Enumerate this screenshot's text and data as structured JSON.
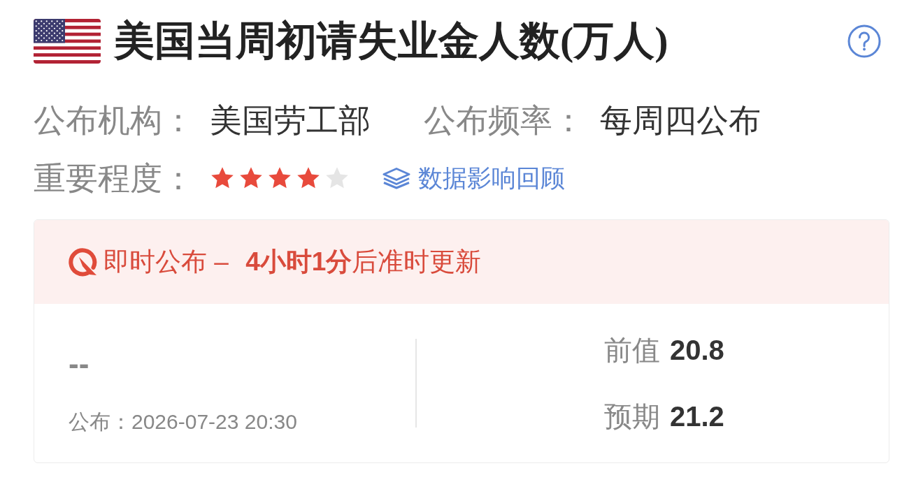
{
  "header": {
    "title": "美国当周初请失业金人数(万人)"
  },
  "info": [
    {
      "label": "公布机构：",
      "value": "美国劳工部"
    },
    {
      "label": "公布频率：",
      "value": "每周四公布"
    }
  ],
  "importance": {
    "label": "重要程度：",
    "stars": 4,
    "link": "数据影响回顾"
  },
  "release": {
    "notice": "即时公布 – **4小时1分**后准时更新",
    "actual": "--",
    "published": "公布：2026-07-23 20:30",
    "figures": [
      {
        "label": "前值",
        "value": "20.8"
      },
      {
        "label": "预期",
        "value": "21.2"
      }
    ]
  }
}
